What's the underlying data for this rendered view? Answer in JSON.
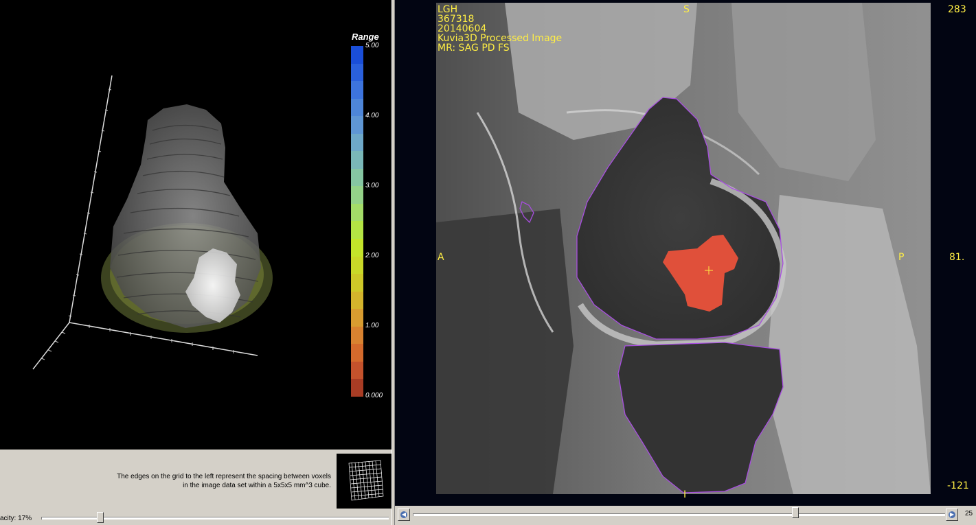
{
  "viewer3d": {
    "colorbar_title": "Range",
    "colorbar_ticks": [
      "5.00",
      "4.00",
      "3.00",
      "2.00",
      "1.00",
      "0.000"
    ],
    "colorbar_colors": [
      "#1a4ed8",
      "#2a60dc",
      "#3d74dd",
      "#4e86d8",
      "#5f96d4",
      "#6ea8c8",
      "#7ab8b8",
      "#86c6a2",
      "#94d288",
      "#a4dc68",
      "#b4e444",
      "#c4e42a",
      "#cad828",
      "#cec828",
      "#d4b42c",
      "#d89c30",
      "#d88230",
      "#d46a2c",
      "#c4522c",
      "#a83c24",
      "#822a1c",
      "#561a14",
      "#2c0e0c",
      "#1a0808",
      "#100404",
      "#080202"
    ]
  },
  "panel": {
    "help_text": "The edges on the grid to the left represent the spacing between voxels in the image data set within a 5x5x5 mm^3 cube.",
    "opacity_label": "acity: 17%",
    "opacity_value": 0.17
  },
  "mri_view": {
    "info_lines": [
      "LGH",
      "367318",
      "20140604",
      "Kuvia3D Processed Image",
      "MR: SAG PD FS"
    ],
    "orientation": {
      "superior": "S",
      "inferior": "I",
      "anterior": "A",
      "posterior": "P"
    },
    "window_values": {
      "top": "283",
      "mid": "81.",
      "bottom": "-121"
    },
    "slice_number": "25",
    "slice_position": 0.72,
    "overlay_color": "#ffee44",
    "roi_color": "#a84ee0",
    "lesion_color": "#e0503a"
  }
}
